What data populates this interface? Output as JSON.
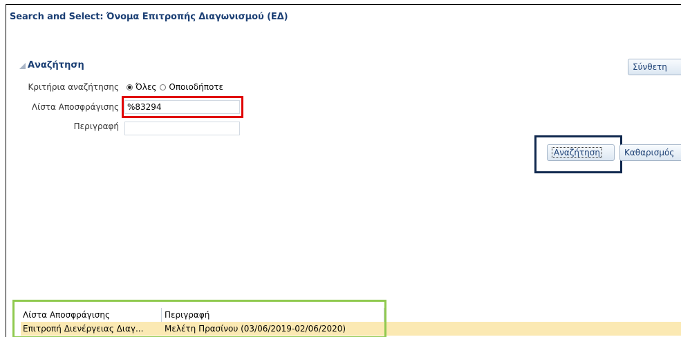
{
  "dialog": {
    "title": "Search and Select: Όνομα Επιτροπής Διαγωνισμού (ΕΔ)"
  },
  "search_section": {
    "label": "Αναζήτηση",
    "advanced_button": "Σύνθετη",
    "criteria_label": "Κριτήρια αναζήτησης",
    "radio_all": "Όλες",
    "radio_any": "Οποιοδήποτε",
    "selected_radio": "Όλες",
    "list_label": "Λίστα Αποσφράγισης",
    "list_value": "%83294",
    "desc_label": "Περιγραφή",
    "desc_value": "",
    "search_button": "Αναζήτηση",
    "clear_button": "Καθαρισμός"
  },
  "results": {
    "columns": [
      "Λίστα Αποσφράγισης",
      "Περιγραφή"
    ],
    "rows": [
      [
        "Επιτροπή Διενέργειας Διαγ...",
        "Μελέτη Πρασίνου (03/06/2019-02/06/2020)"
      ]
    ]
  },
  "annotation_colors": {
    "input_highlight": "#e00000",
    "button_highlight": "#10284e",
    "result_highlight": "#8fc94e"
  }
}
